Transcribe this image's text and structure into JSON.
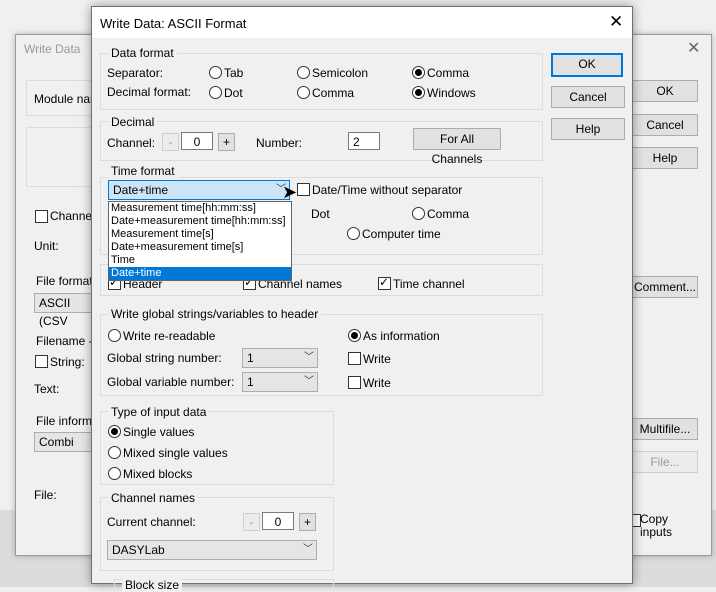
{
  "background_window": {
    "title": "Write Data",
    "module_name_label": "Module nam",
    "channel_label": "Channel",
    "unit_label": "Unit:",
    "file_format_label": "File format",
    "file_format_value": "ASCII (CSV",
    "filename_label": "Filename ->",
    "string_label": "String:",
    "text_label": "Text:",
    "file_info_label": "File informa",
    "file_info_value": "Combi",
    "file_label": "File:",
    "ok": "OK",
    "cancel": "Cancel",
    "help": "Help",
    "comment": "Comment...",
    "multifile": "Multifile...",
    "file_button": "File...",
    "copy_inputs": "Copy inputs"
  },
  "dialog": {
    "title": "Write Data: ASCII Format",
    "buttons": {
      "ok": "OK",
      "cancel": "Cancel",
      "help": "Help"
    },
    "data_format": {
      "legend": "Data format",
      "separator_label": "Separator:",
      "separator_options": [
        "Tab",
        "Semicolon",
        "Comma"
      ],
      "separator_selected": "Comma",
      "decimal_label": "Decimal format:",
      "decimal_options": [
        "Dot",
        "Comma",
        "Windows"
      ],
      "decimal_selected": "Windows"
    },
    "decimal": {
      "legend": "Decimal",
      "channel_label": "Channel:",
      "minus": "-",
      "channel_value": "0",
      "plus": "+",
      "number_label": "Number:",
      "number_value": "2",
      "for_all_channels": "For All Channels"
    },
    "time_format": {
      "legend": "Time format",
      "selected": "Date+time",
      "without_separator": "Date/Time without separator",
      "dot": "Dot",
      "comma": "Comma",
      "computer_time": "Computer time",
      "dropdown_items": [
        "Measurement time[hh:mm:ss]",
        "Date+measurement time[hh:mm:ss]",
        "Measurement time[s]",
        "Date+measurement time[s]",
        "Time",
        "Date+time"
      ]
    },
    "header_options": {
      "header": "Header",
      "channel_names": "Channel names",
      "time_channel": "Time channel"
    },
    "global_strings": {
      "legend": "Write global strings/variables to header",
      "write_readable": "Write re-readable",
      "as_information": "As information",
      "string_number_label": "Global string number:",
      "string_number_value": "1",
      "variable_number_label": "Global variable number:",
      "variable_number_value": "1",
      "write": "Write"
    },
    "input_type": {
      "legend": "Type of input data",
      "options": [
        "Single values",
        "Mixed single values",
        "Mixed blocks"
      ],
      "selected": "Single values"
    },
    "channel_names": {
      "legend": "Channel names",
      "current_channel_label": "Current channel:",
      "minus": "-",
      "value": "0",
      "plus": "+",
      "combo_value": "DASYLab"
    },
    "block_size": "Block size"
  }
}
